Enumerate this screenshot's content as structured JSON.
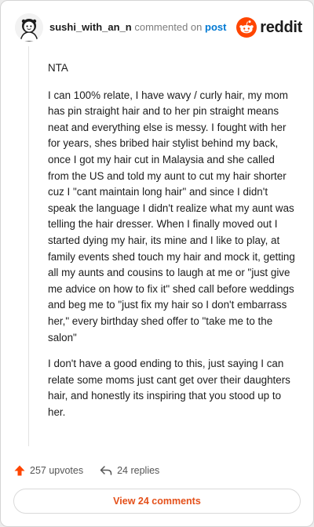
{
  "header": {
    "username": "sushi_with_an_n",
    "commented_on": "commented on",
    "post_link": "post",
    "brand_wordmark": "reddit"
  },
  "comment": {
    "paragraphs": [
      "NTA",
      "I can 100% relate, I have wavy / curly hair, my mom has pin straight hair and to her pin straight means neat and everything else is messy. I fought with her for years, shes bribed hair stylist behind my back, once I got my hair cut in Malaysia and she called from the US and told my aunt to cut my hair shorter cuz I \"cant maintain long hair\" and since I didn't speak the language I didn't realize what my aunt was telling the hair dresser. When I finally moved out I started dying my hair, its mine and I like to play, at family events shed touch my hair and mock it, getting all my aunts and cousins to laugh at me or \"just give me advice on how to fix it\" shed call before weddings and beg me to \"just fix my hair so I don't embarrass her,\" every birthday shed offer to \"take me to the salon\"",
      "I don't have a good ending to this, just saying I can relate some moms just cant get over their daughters hair, and honestly its inspiring that you stood up to her."
    ]
  },
  "footer": {
    "upvotes": "257 upvotes",
    "replies": "24 replies",
    "view_comments": "View 24 comments"
  },
  "colors": {
    "reddit_orange": "#ff4500",
    "link_blue": "#0079d3",
    "button_text": "#e4501a"
  },
  "icons": {
    "avatar": "snoo-avatar-icon",
    "brand": "reddit-snoo-icon",
    "upvote": "upvote-arrow-icon",
    "reply": "reply-arrow-icon"
  }
}
